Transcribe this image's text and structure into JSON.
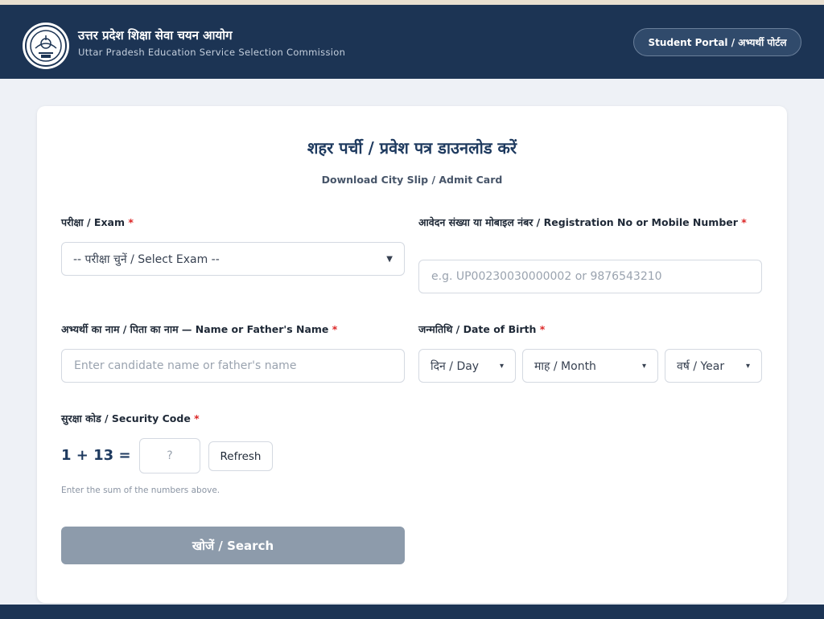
{
  "header": {
    "title_hi": "उत्तर प्रदेश शिक्षा सेवा चयन आयोग",
    "title_en": "Uttar Pradesh Education Service Selection Commission",
    "portal_button": "Student Portal / अभ्यर्थी पोर्टल",
    "logo_icon": "commission-seal-icon"
  },
  "form": {
    "title": "शहर पर्ची / प्रवेश पत्र डाउनलोड करें",
    "subtitle": "Download City Slip / Admit Card",
    "required_mark": "*",
    "exam": {
      "label": "परीक्षा / Exam",
      "selected": "-- परीक्षा चुनें / Select Exam --"
    },
    "registration": {
      "label": "आवेदन संख्या या मोबाइल नंबर / Registration No or Mobile Number",
      "placeholder": "e.g. UP00230030000002 or 9876543210",
      "value": ""
    },
    "name": {
      "label": "अभ्यर्थी का नाम / पिता का नाम — Name or Father's Name",
      "placeholder": "Enter candidate name or father's name",
      "value": ""
    },
    "dob": {
      "label": "जन्मतिथि / Date of Birth",
      "day": "दिन / Day",
      "month": "माह / Month",
      "year": "वर्ष / Year"
    },
    "security": {
      "label": "सुरक्षा कोड / Security Code",
      "equation": "1 + 13 =",
      "placeholder": "?",
      "refresh": "Refresh",
      "hint": "Enter the sum of the numbers above."
    },
    "search_button": "खोजें / Search"
  },
  "colors": {
    "header_bg": "#1c3454",
    "title": "#1e3a5f",
    "required": "#dc2626",
    "search_button_bg": "#8d9bab"
  }
}
